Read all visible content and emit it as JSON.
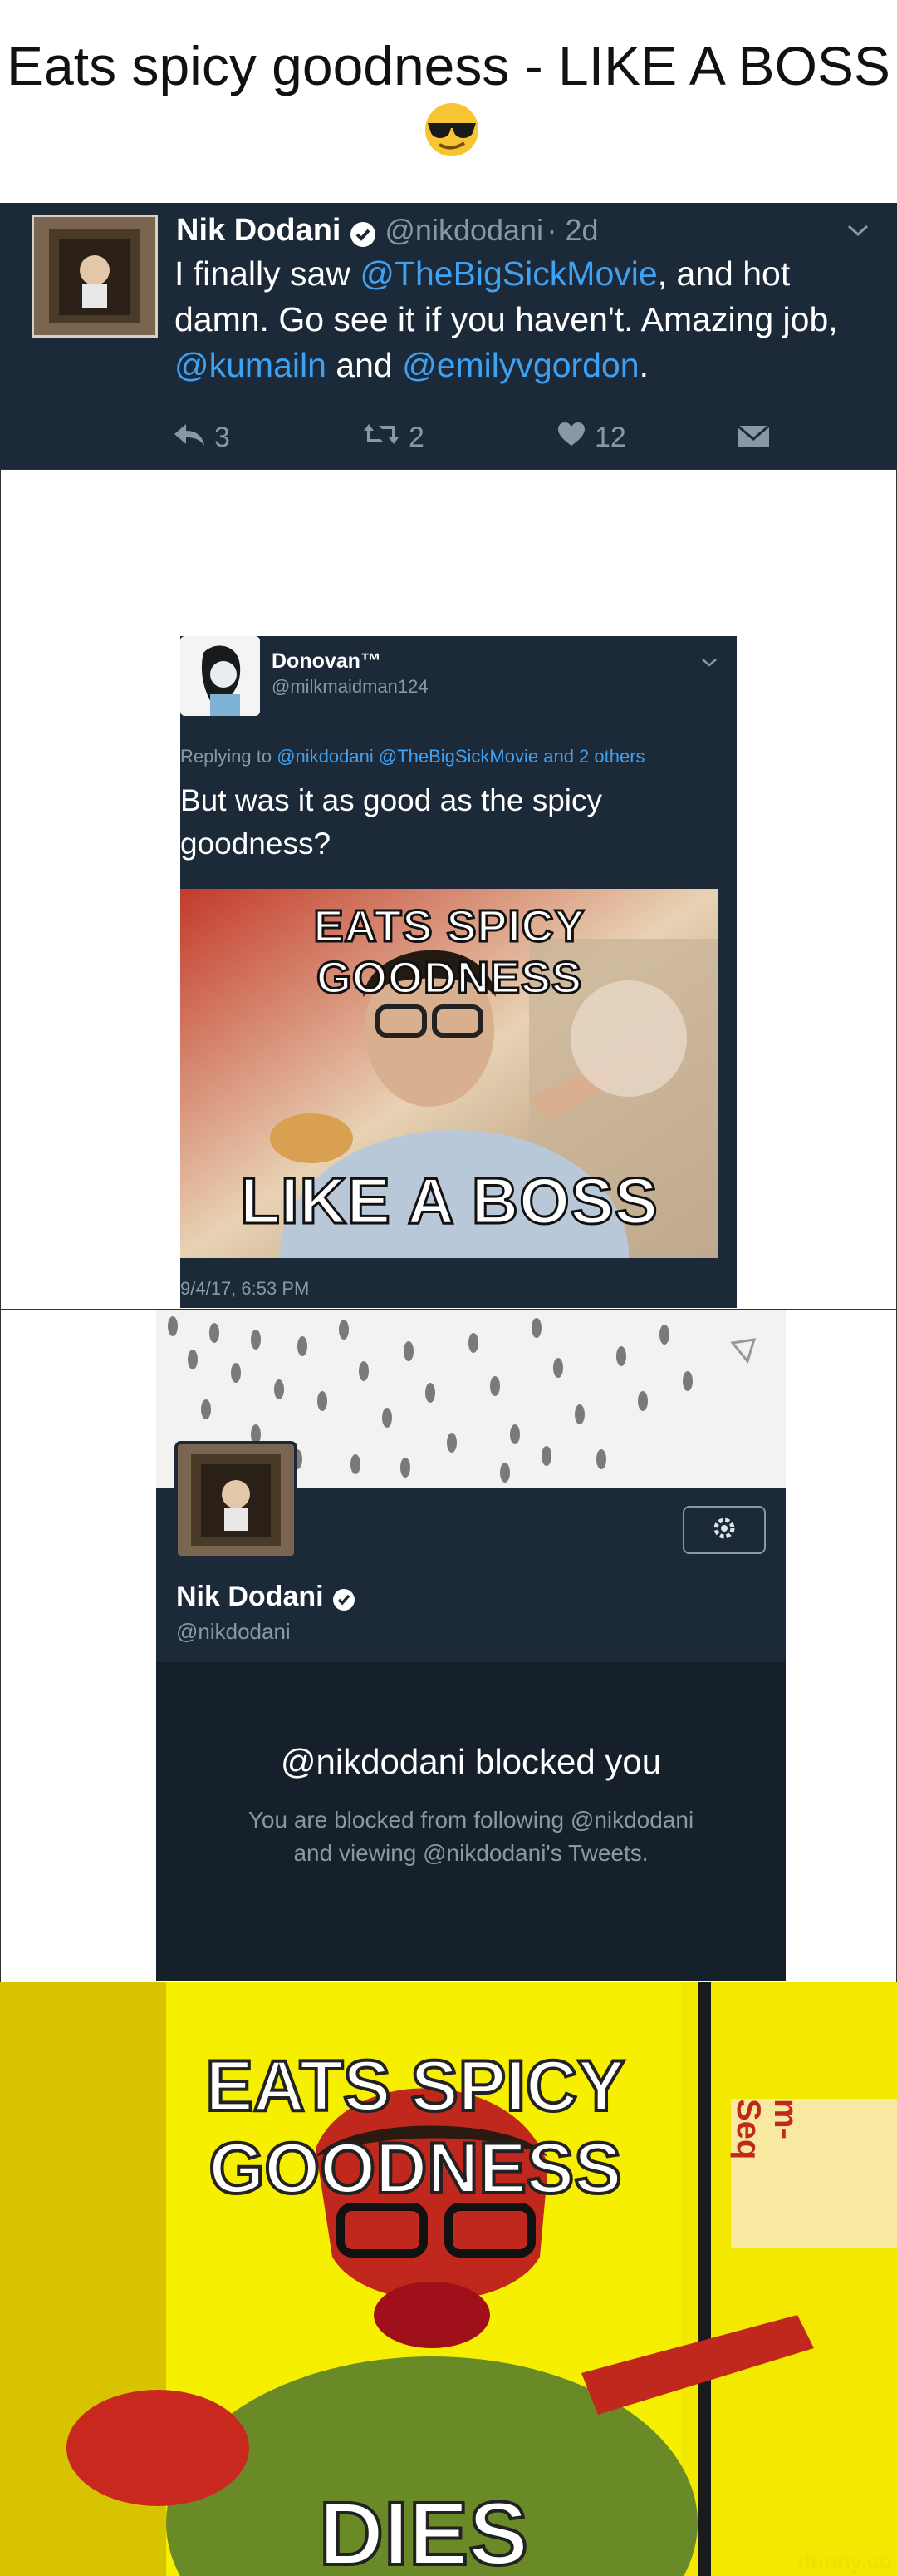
{
  "title": "Eats spicy goodness - LIKE A BOSS",
  "icons": {
    "emoji": "sunglasses-emoji"
  },
  "tweet": {
    "name": "Nik Dodani",
    "handle": "@nikdodani",
    "time": "· 2d",
    "body_1": "I finally saw ",
    "mention_movie": "@TheBigSickMovie",
    "body_2": ", and hot damn. Go see it if you haven't. Amazing job, ",
    "mention_kumail": "@kumailn",
    "body_3": " and ",
    "mention_emily": "@emilyvgordon",
    "body_4": ".",
    "reply_count": "3",
    "retweet_count": "2",
    "like_count": "12"
  },
  "reply": {
    "name": "Donovan™",
    "handle": "@milkmaidman124",
    "replying_label": "Replying to ",
    "replying_targets": "@nikdodani @TheBigSickMovie and 2 others",
    "body": "But was it as good as the spicy goodness?",
    "meme_top": "EATS SPICY GOODNESS",
    "meme_bottom": "LIKE A BOSS",
    "timestamp": "9/4/17, 6:53 PM"
  },
  "profile": {
    "name": "Nik Dodani",
    "handle": "@nikdodani",
    "blocked_title": "@nikdodani blocked you",
    "blocked_line1": "You are blocked from following @nikdodani",
    "blocked_line2": "and viewing @nikdodani's Tweets."
  },
  "fried": {
    "top": "EATS SPICY GOODNESS",
    "bottom": "DIES",
    "side_text": "m-Seq",
    "watermark": "ifunny.co"
  },
  "colors": {
    "twitter_bg": "#1c2938",
    "mention": "#3ea1f2",
    "muted": "#8899a6",
    "fried_yellow": "#f6f000"
  }
}
